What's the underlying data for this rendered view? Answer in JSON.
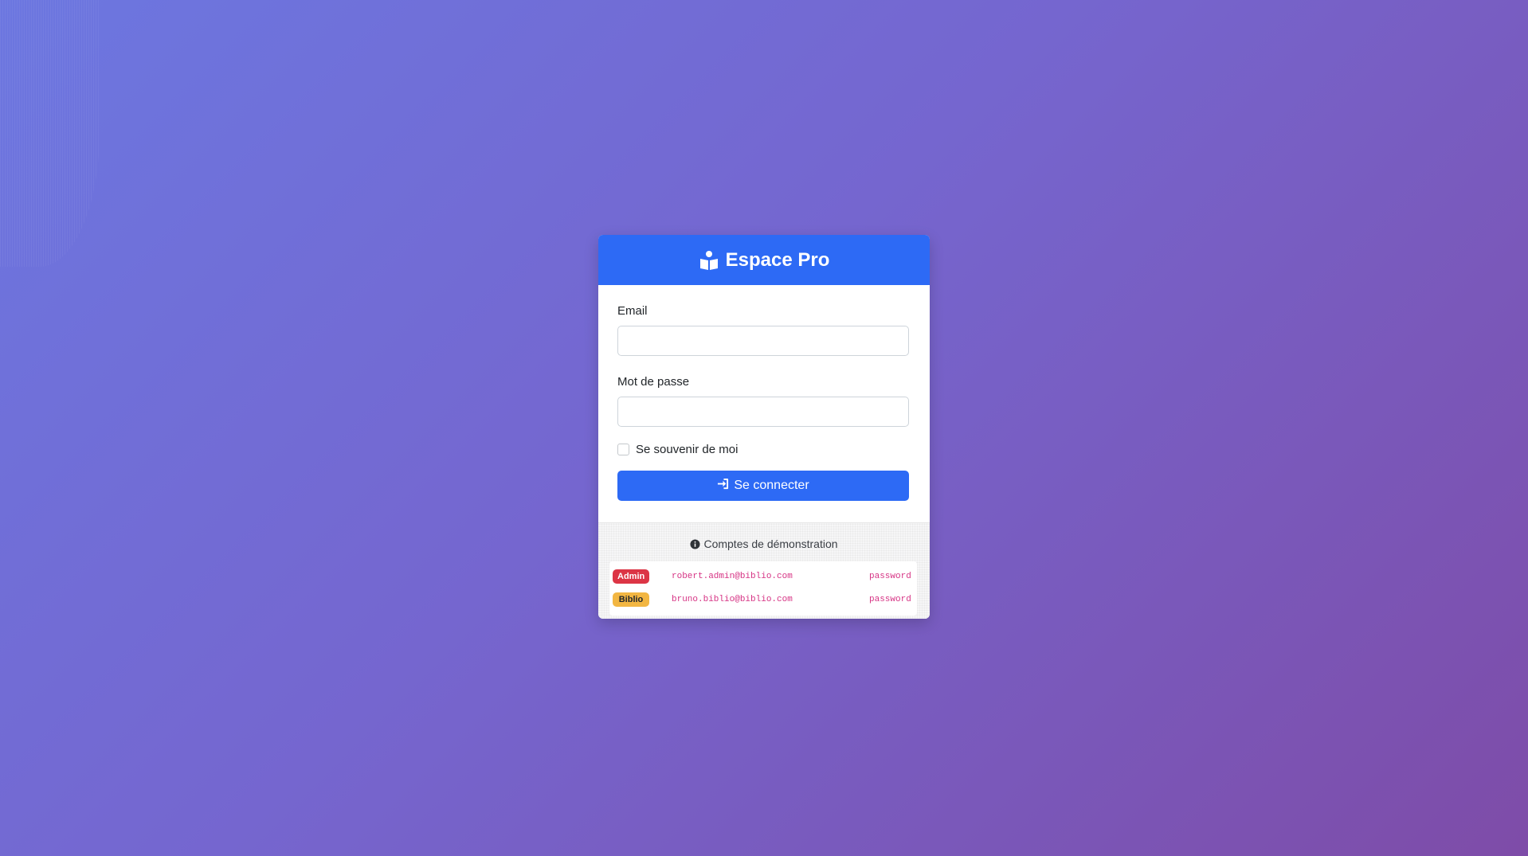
{
  "header": {
    "title": "Espace Pro",
    "icon": "book-reader-icon",
    "color": "#2d6af5"
  },
  "form": {
    "email_label": "Email",
    "email_value": "",
    "email_placeholder": "",
    "password_label": "Mot de passe",
    "password_value": "",
    "password_placeholder": "",
    "remember_label": "Se souvenir de moi",
    "remember_checked": false,
    "submit_label": "Se connecter",
    "submit_icon": "sign-in-icon"
  },
  "demo": {
    "title": "Comptes de démonstration",
    "icon": "info-circle-icon",
    "accounts": [
      {
        "role": "Admin",
        "email": "robert.admin@biblio.com",
        "password": "password",
        "badge_color": "#dc3545"
      },
      {
        "role": "Biblio",
        "email": "bruno.biblio@biblio.com",
        "password": "password",
        "badge_color": "#f2b642"
      }
    ]
  }
}
